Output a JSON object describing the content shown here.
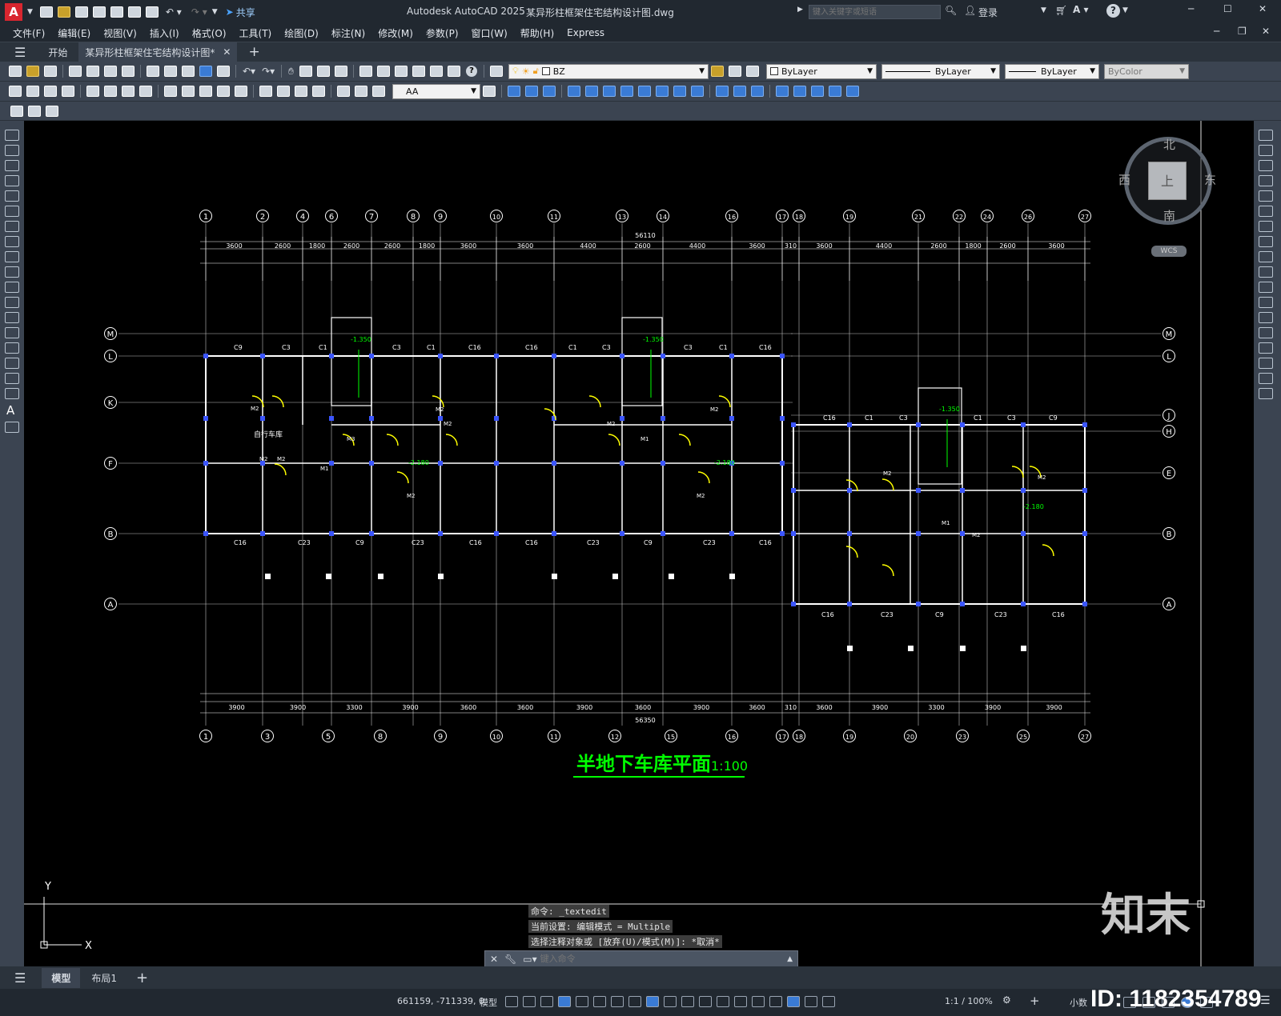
{
  "app": {
    "title": "Autodesk AutoCAD 2025",
    "file": "某异形柱框架住宅结构设计图.dwg",
    "share_label": "共享",
    "search_placeholder": "键入关键字或短语",
    "login_label": "登录"
  },
  "menu": [
    "文件(F)",
    "编辑(E)",
    "视图(V)",
    "插入(I)",
    "格式(O)",
    "工具(T)",
    "绘图(D)",
    "标注(N)",
    "修改(M)",
    "参数(P)",
    "窗口(W)",
    "帮助(H)",
    "Express"
  ],
  "tabs": {
    "start": "开始",
    "doc": "某异形柱框架住宅结构设计图*"
  },
  "layer_combo": "BZ",
  "props": {
    "color": "ByLayer",
    "linetype": "ByLayer",
    "lineweight": "ByLayer",
    "plotstyle": "ByColor"
  },
  "text_style": "AA",
  "viewcube": {
    "north": "北",
    "south": "南",
    "east": "东",
    "west": "西",
    "top": "上",
    "wcs": "WCS"
  },
  "drawing": {
    "title": "半地下车库平面",
    "scale": "1:100",
    "top_axes": [
      "1",
      "2",
      "4",
      "6",
      "7",
      "8",
      "9",
      "10",
      "11",
      "13",
      "14",
      "16",
      "17",
      "18",
      "19",
      "21",
      "22",
      "24",
      "26",
      "27"
    ],
    "bottom_axes": [
      "1",
      "3",
      "5",
      "8",
      "9",
      "10",
      "11",
      "12",
      "15",
      "16",
      "17",
      "18",
      "19",
      "20",
      "23",
      "25",
      "27"
    ],
    "left_axes": [
      "M",
      "L",
      "K",
      "F",
      "B",
      "A"
    ],
    "right_axes": [
      "M",
      "L",
      "J",
      "H",
      "E",
      "B",
      "A"
    ],
    "total_top": "56110",
    "total_bottom": "56350",
    "top_dims": [
      "3600",
      "2600",
      "1800",
      "2600",
      "2600",
      "1800",
      "3600",
      "3600",
      "4400",
      "2600",
      "4400",
      "3600",
      "310",
      "3600",
      "4400",
      "2600",
      "1800",
      "2600",
      "3600"
    ],
    "bottom_dims": [
      "3900",
      "3900",
      "3300",
      "3900",
      "3600",
      "3600",
      "3900",
      "3600",
      "3900",
      "3600",
      "310",
      "3600",
      "3900",
      "3300",
      "3900",
      "3900"
    ],
    "labels": [
      "自行车库",
      "-1.350",
      "-2.180",
      "M2",
      "C1",
      "C3",
      "C9",
      "C16",
      "C23",
      "M1",
      "M3"
    ]
  },
  "command": {
    "history": [
      "命令: _textedit",
      "当前设置: 编辑模式 = Multiple",
      "选择注释对象或 [放弃(U)/模式(M)]: *取消*"
    ],
    "placeholder": "键入命令"
  },
  "layout_tabs": [
    "模型",
    "布局1"
  ],
  "status": {
    "coords": "661159, -711339, 0",
    "model": "模型",
    "scale": "1:1 / 100%",
    "units": "小数"
  },
  "watermark": {
    "brand": "知末",
    "id": "ID: 1182354789"
  },
  "colors": {
    "bg": "#000000",
    "ui": "#3b4451",
    "title": "#00ff00",
    "walls": "#ffffff",
    "columns": "#3b55ff",
    "doors": "#ffff00"
  }
}
